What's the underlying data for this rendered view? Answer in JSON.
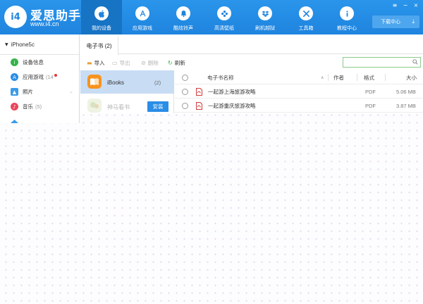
{
  "app": {
    "logo_mark": "i4",
    "title": "爱思助手",
    "url": "www.i4.cn"
  },
  "nav": {
    "items": [
      {
        "label": "我的设备",
        "icon": "apple-icon",
        "active": true
      },
      {
        "label": "应用游戏",
        "icon": "app-store-icon",
        "active": false
      },
      {
        "label": "酷炫铃声",
        "icon": "bell-icon",
        "active": false
      },
      {
        "label": "高清壁纸",
        "icon": "flower-icon",
        "active": false
      },
      {
        "label": "刷机越狱",
        "icon": "dropbox-icon",
        "active": false
      },
      {
        "label": "工具箱",
        "icon": "tools-icon",
        "active": false
      },
      {
        "label": "教程中心",
        "icon": "info-icon",
        "active": false
      }
    ]
  },
  "window_controls": {
    "menu": "≡",
    "minimize": "−",
    "close": "×"
  },
  "download_center": {
    "label": "下载中心",
    "icon": "⤓"
  },
  "sidebar": {
    "device": "iPhone5c",
    "items": [
      {
        "label": "设备信息",
        "count": "",
        "icon": "info-icon",
        "color": "#34b34a"
      },
      {
        "label": "应用游戏",
        "count": "(14",
        "icon": "app-store-icon",
        "color": "#2a8de6"
      },
      {
        "label": "照片",
        "count": "",
        "icon": "photo-icon",
        "color": "#3a9be8"
      },
      {
        "label": "音乐",
        "count": "(5)",
        "icon": "music-icon",
        "color": "#e8455a"
      }
    ]
  },
  "tabs": [
    {
      "label": "电子书 (2)"
    }
  ],
  "toolbar": {
    "import_label": "导入",
    "export_label": "导出",
    "delete_label": "删除",
    "refresh_label": "刷新",
    "search_placeholder": ""
  },
  "apps": [
    {
      "name": "iBooks",
      "count": "(2)",
      "selected": true,
      "icon": "ibooks-icon"
    },
    {
      "name": "神马看书",
      "count": "",
      "selected": false,
      "icon": "reader-app-icon",
      "action_label": "安装"
    }
  ],
  "table": {
    "columns": {
      "name": "电子书名称",
      "author": "作者",
      "format": "格式",
      "size": "大小"
    },
    "rows": [
      {
        "name": "一起游上海旅游攻略",
        "author": "",
        "format": "PDF",
        "size": "5.06 MB"
      },
      {
        "name": "一起游重庆旅游攻略",
        "author": "",
        "format": "PDF",
        "size": "3.87 MB"
      }
    ]
  },
  "colors": {
    "topbar": "#1f84de",
    "topbar_active": "#1773c4",
    "selected_row": "#c8dcf4",
    "install_button": "#2a8de6",
    "search_border": "#8acb8a"
  }
}
